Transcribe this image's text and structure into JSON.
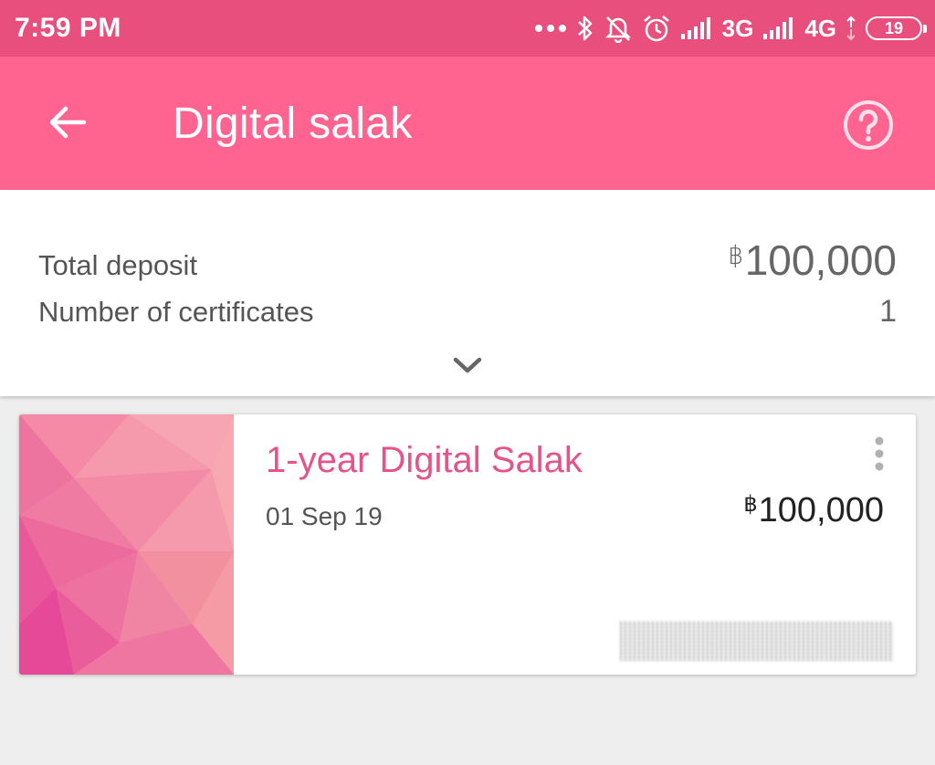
{
  "status_bar": {
    "time": "7:59 PM",
    "network_1": "3G",
    "network_2": "4G",
    "battery": "19",
    "icons": [
      "more-dots-icon",
      "bluetooth-icon",
      "silent-bell-icon",
      "alarm-icon",
      "signal-icon",
      "battery-icon"
    ]
  },
  "app_bar": {
    "title": "Digital salak",
    "back_icon": "arrow-left-icon",
    "help_icon": "help-circle-icon"
  },
  "summary": {
    "total_deposit_label": "Total deposit",
    "currency_symbol": "฿",
    "total_deposit_value": "100,000",
    "certificates_label": "Number of certificates",
    "certificates_count": "1",
    "expand_icon": "chevron-down-icon"
  },
  "certificates": [
    {
      "title": "1-year Digital Salak",
      "date": "01 Sep 19",
      "currency_symbol": "฿",
      "amount": "100,000",
      "menu_icon": "more-vertical-icon"
    }
  ],
  "colors": {
    "status_bar": "#e94f7d",
    "app_bar": "#ff6490",
    "accent_text": "#e5538a",
    "background": "#eeeeee"
  }
}
